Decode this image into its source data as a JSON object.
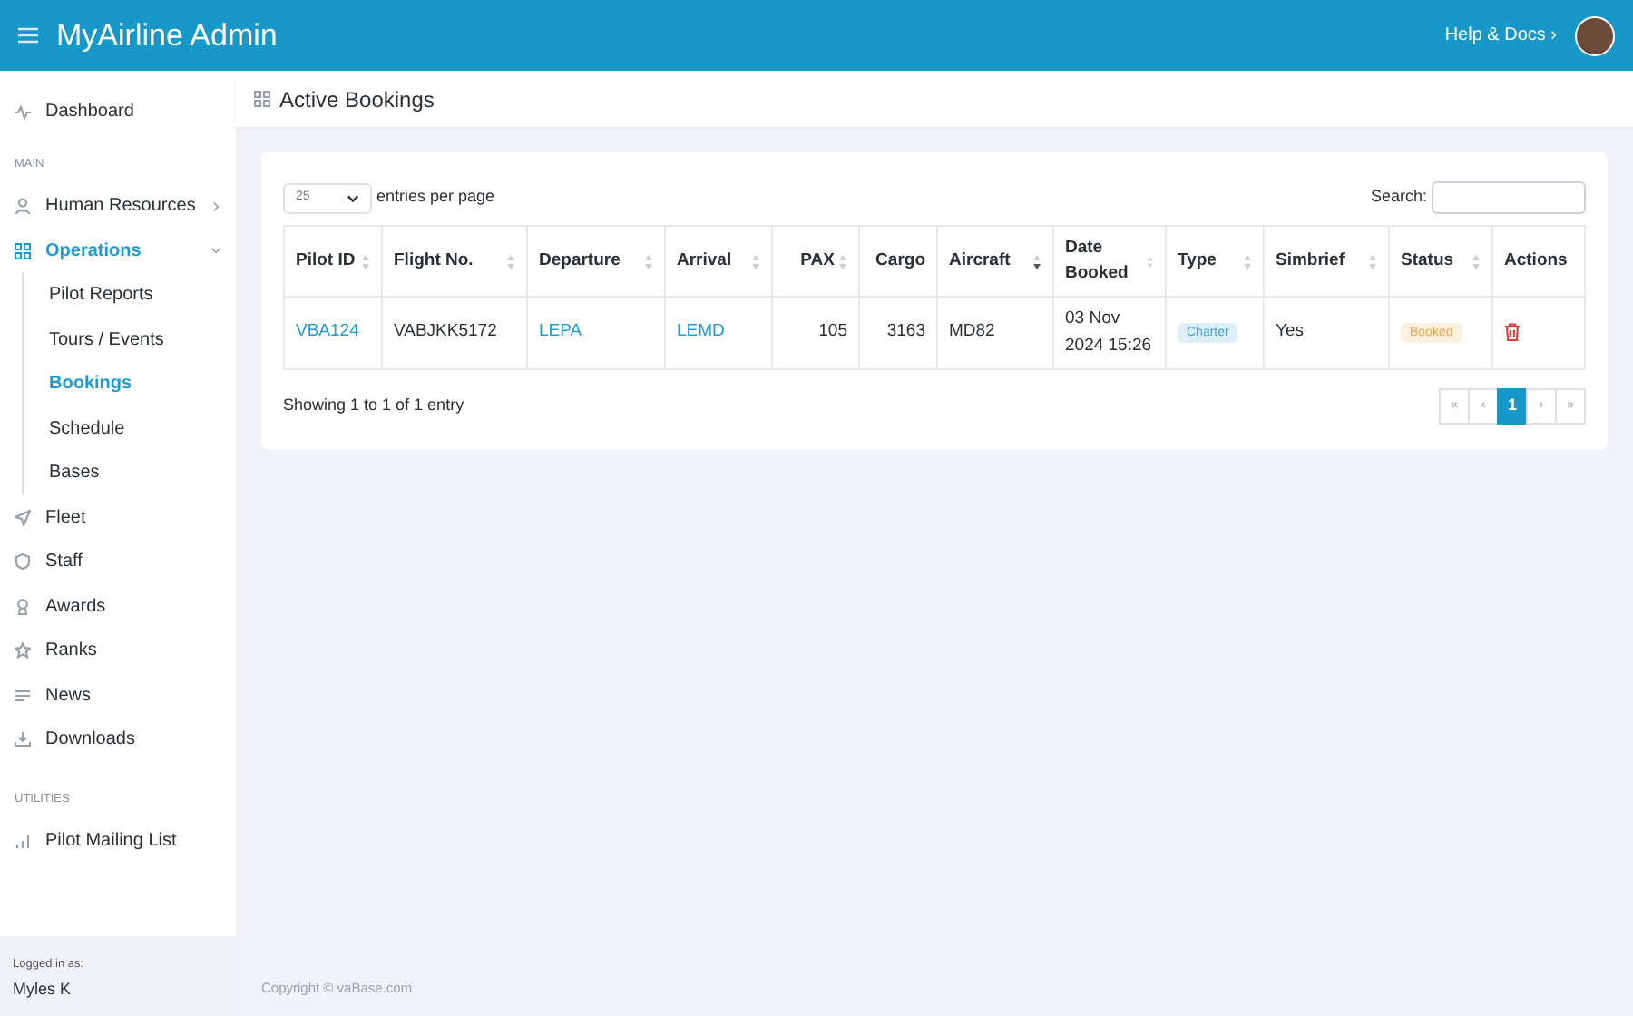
{
  "topbar": {
    "title": "MyAirline Admin",
    "help_link": "Help & Docs ›"
  },
  "sidebar": {
    "groups": [
      {
        "items": [
          {
            "label": "Dashboard",
            "selected": false
          }
        ]
      },
      {
        "heading": "MAIN",
        "items": [
          {
            "label": "Human Resources",
            "selected": false,
            "expanded": false
          },
          {
            "label": "Operations",
            "selected": true,
            "expanded": true,
            "children": [
              {
                "label": "Pilot Reports",
                "selected": false
              },
              {
                "label": "Tours / Events",
                "selected": false
              },
              {
                "label": "Bookings",
                "selected": true
              },
              {
                "label": "Schedule",
                "selected": false
              },
              {
                "label": "Bases",
                "selected": false
              }
            ]
          },
          {
            "label": "Fleet",
            "selected": false
          },
          {
            "label": "Staff",
            "selected": false
          },
          {
            "label": "Awards",
            "selected": false
          },
          {
            "label": "Ranks",
            "selected": false
          },
          {
            "label": "News",
            "selected": false
          },
          {
            "label": "Downloads",
            "selected": false
          }
        ]
      },
      {
        "heading": "UTILITIES",
        "items": [
          {
            "label": "Pilot Mailing List",
            "selected": false
          }
        ]
      }
    ],
    "footer_label": "Logged in as:",
    "user": "Myles K"
  },
  "page_title": "Active Bookings",
  "table_controls": {
    "page_size": "25",
    "page_size_label": "entries per page",
    "search_label": "Search:"
  },
  "table": {
    "columns": [
      {
        "label": "Pilot ID",
        "sortable": true,
        "sorted_descending": false
      },
      {
        "label": "Flight No.",
        "sortable": true,
        "sorted_descending": false
      },
      {
        "label": "Departure",
        "sortable": true,
        "sorted_descending": false
      },
      {
        "label": "Arrival",
        "sortable": true,
        "sorted_descending": false
      },
      {
        "label": "PAX",
        "sortable": true,
        "sorted_descending": false
      },
      {
        "label": "Cargo",
        "sortable": false
      },
      {
        "label": "Aircraft",
        "sortable": true,
        "sorted_descending": true
      },
      {
        "label": "Date Booked",
        "sortable": true,
        "sorted_descending": false
      },
      {
        "label": "Type",
        "sortable": true,
        "sorted_descending": false
      },
      {
        "label": "Simbrief",
        "sortable": true,
        "sorted_descending": false
      },
      {
        "label": "Status",
        "sortable": true,
        "sorted_descending": false
      },
      {
        "label": "Actions",
        "sortable": false
      }
    ],
    "rows": [
      {
        "cells": [
          {
            "kind": "link",
            "text": "VBA124"
          },
          {
            "kind": "text",
            "text": "VABJKK5172"
          },
          {
            "kind": "link",
            "text": "LEPA"
          },
          {
            "kind": "link",
            "text": "LEMD"
          },
          {
            "kind": "number",
            "text": "105"
          },
          {
            "kind": "number",
            "text": "3163"
          },
          {
            "kind": "text",
            "text": "MD82"
          },
          {
            "kind": "text",
            "text": "03 Nov 2024 15:26"
          },
          {
            "kind": "badge",
            "text": "Charter",
            "color": "#3ba3d8"
          },
          {
            "kind": "text",
            "text": "Yes"
          },
          {
            "kind": "badge",
            "text": "Booked",
            "color": "#e8a94a"
          },
          {
            "kind": "delete"
          }
        ]
      }
    ]
  },
  "summary": "Showing 1 to 1 of 1 entry",
  "pagination": [
    {
      "label": "«",
      "selected": false
    },
    {
      "label": "‹",
      "selected": false
    },
    {
      "label": "1",
      "selected": true
    },
    {
      "label": "›",
      "selected": false
    },
    {
      "label": "»",
      "selected": false
    }
  ],
  "copyright": "Copyright © vaBase.com"
}
